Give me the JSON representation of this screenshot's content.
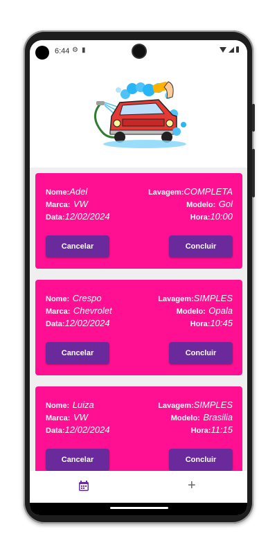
{
  "status_bar": {
    "time": "6:44"
  },
  "bookings": [
    {
      "nome_label": "Nome:",
      "nome": "Adel",
      "lavagem_label": "Lavagem:",
      "lavagem": "COMPLETA",
      "marca_label": "Marca:",
      "marca": "VW",
      "modelo_label": "Modelo:",
      "modelo": "Gol",
      "data_label": "Data:",
      "data": "12/02/2024",
      "hora_label": "Hora:",
      "hora": "10:00",
      "cancel_label": "Cancelar",
      "done_label": "Concluir"
    },
    {
      "nome_label": "Nome:",
      "nome": "Crespo",
      "lavagem_label": "Lavagem:",
      "lavagem": "SIMPLES",
      "marca_label": "Marca:",
      "marca": "Chevrolet",
      "modelo_label": "Modelo:",
      "modelo": "Opala",
      "data_label": "Data:",
      "data": "12/02/2024",
      "hora_label": "Hora:",
      "hora": "10:45",
      "cancel_label": "Cancelar",
      "done_label": "Concluir"
    },
    {
      "nome_label": "Nome:",
      "nome": "Luiza",
      "lavagem_label": "Lavagem:",
      "lavagem": "SIMPLES",
      "marca_label": "Marca:",
      "marca": "VW",
      "modelo_label": "Modelo:",
      "modelo": "Brasilia",
      "data_label": "Data:",
      "data": "12/02/2024",
      "hora_label": "Hora:",
      "hora": "11:15",
      "cancel_label": "Cancelar",
      "done_label": "Concluir"
    }
  ],
  "bottom_nav": {
    "plus_symbol": "+",
    "calendar_icon": "calendar-icon",
    "add_icon": "plus-icon"
  },
  "colors": {
    "card": "#ff0f91",
    "button": "#6a2a9c",
    "nav_active": "#6a2a9c"
  }
}
